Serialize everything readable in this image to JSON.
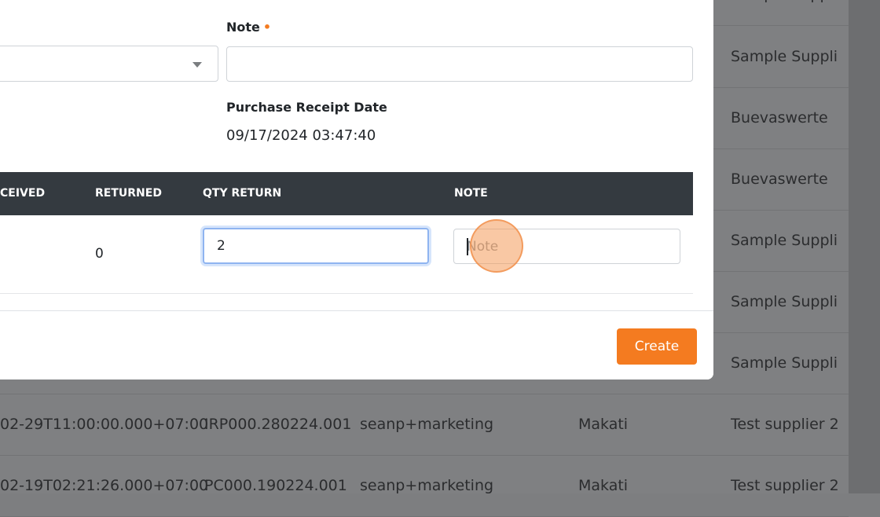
{
  "form": {
    "note_label": "Note",
    "note_value": "",
    "receipt_date_label": "Purchase Receipt Date",
    "receipt_date_value": "09/17/2024 03:47:40"
  },
  "items_table": {
    "headers": [
      "CEIVED",
      "RETURNED",
      "QTY RETURN",
      "NOTE"
    ],
    "row": {
      "returned": "0",
      "qty_return": "2",
      "note_placeholder": "Note"
    }
  },
  "footer": {
    "create_label": "Create"
  },
  "background_table": {
    "rows": [
      {
        "date": "",
        "ref": "",
        "user": "",
        "location": "",
        "supplier": "Sample Suppli"
      },
      {
        "date": "",
        "ref": "",
        "user": "",
        "location": "",
        "supplier": "Buevaswerte"
      },
      {
        "date": "",
        "ref": "",
        "user": "",
        "location": "",
        "supplier": "Buevaswerte"
      },
      {
        "date": "",
        "ref": "",
        "user": "",
        "location": "",
        "supplier": "Sample Suppli"
      },
      {
        "date": "",
        "ref": "",
        "user": "",
        "location": "",
        "supplier": "Sample Suppli"
      },
      {
        "date": "",
        "ref": "",
        "user": "",
        "location": "",
        "supplier": "Sample Suppli"
      },
      {
        "date": "02-29T11:00:00.000+07:00",
        "ref": "IRP000.280224.001",
        "user": "seanp+marketing",
        "location": "Makati",
        "supplier": "Test supplier 2"
      },
      {
        "date": "02-19T02:21:26.000+07:00",
        "ref": "PC000.190224.001",
        "user": "seanp+marketing",
        "location": "Makati",
        "supplier": "Test supplier 2"
      }
    ]
  },
  "colors": {
    "accent": "#f47b20",
    "table_header_bg": "#343a40",
    "overlay": "#7f8082"
  }
}
